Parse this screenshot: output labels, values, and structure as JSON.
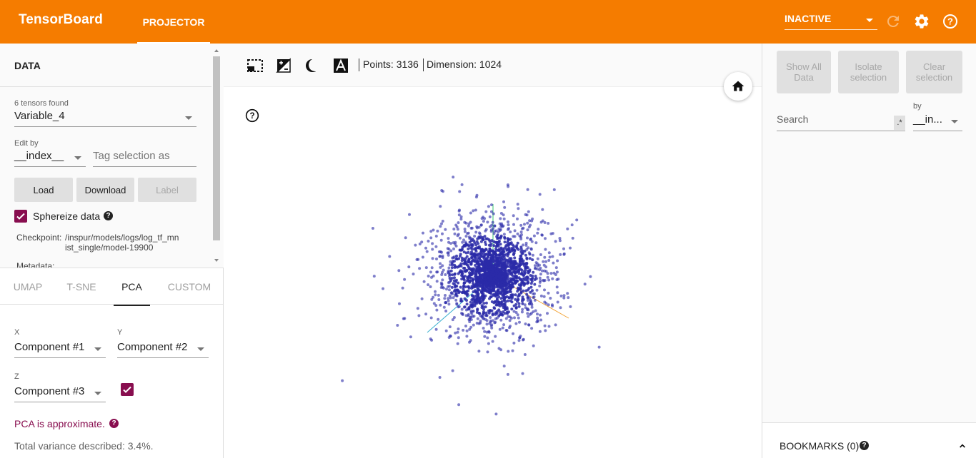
{
  "header": {
    "brand": "TensorBoard",
    "tab": "PROJECTOR",
    "run_select": "INACTIVE",
    "icons": [
      "refresh-icon",
      "gear-icon",
      "help-icon"
    ]
  },
  "data_panel": {
    "title": "DATA",
    "tensors_found": "6 tensors found",
    "tensor_value": "Variable_4",
    "edit_by_label": "Edit by",
    "edit_by_value": "__index__",
    "tag_placeholder": "Tag selection as",
    "buttons": {
      "load": "Load",
      "download": "Download",
      "label": "Label"
    },
    "sphereize_label": "Sphereize data",
    "sphereize_checked": true,
    "checkpoint_label": "Checkpoint:",
    "checkpoint_value": "/inspur/models/logs/log_tf_mnist_single/model-19900",
    "metadata_label": "Metadata:"
  },
  "projection_tabs": [
    "UMAP",
    "T-SNE",
    "PCA",
    "CUSTOM"
  ],
  "active_projection": "PCA",
  "pca": {
    "x_label": "X",
    "x_value": "Component #1",
    "y_label": "Y",
    "y_value": "Component #2",
    "z_label": "Z",
    "z_value": "Component #3",
    "z_enabled": true,
    "approx_text": "PCA is approximate.",
    "variance_text": "Total variance described: 3.4%."
  },
  "toolbar": {
    "icons": [
      "select-icon",
      "night-mode-icon",
      "contrast-icon",
      "label-icon"
    ],
    "points_text": "Points: 3136",
    "dimension_text": "Dimension: 1024"
  },
  "scatter": {
    "point_color": "#2a2aa8",
    "point_count": 3136
  },
  "inspector": {
    "show_all": "Show All Data",
    "isolate": "Isolate selection",
    "clear": "Clear selection",
    "search_placeholder": "Search",
    "regex_label": ".*",
    "by_label": "by",
    "by_value": "__in..."
  },
  "bookmarks": {
    "label": "BOOKMARKS (0)"
  },
  "colors": {
    "header": "#f57c00",
    "accent": "#880e4f"
  }
}
